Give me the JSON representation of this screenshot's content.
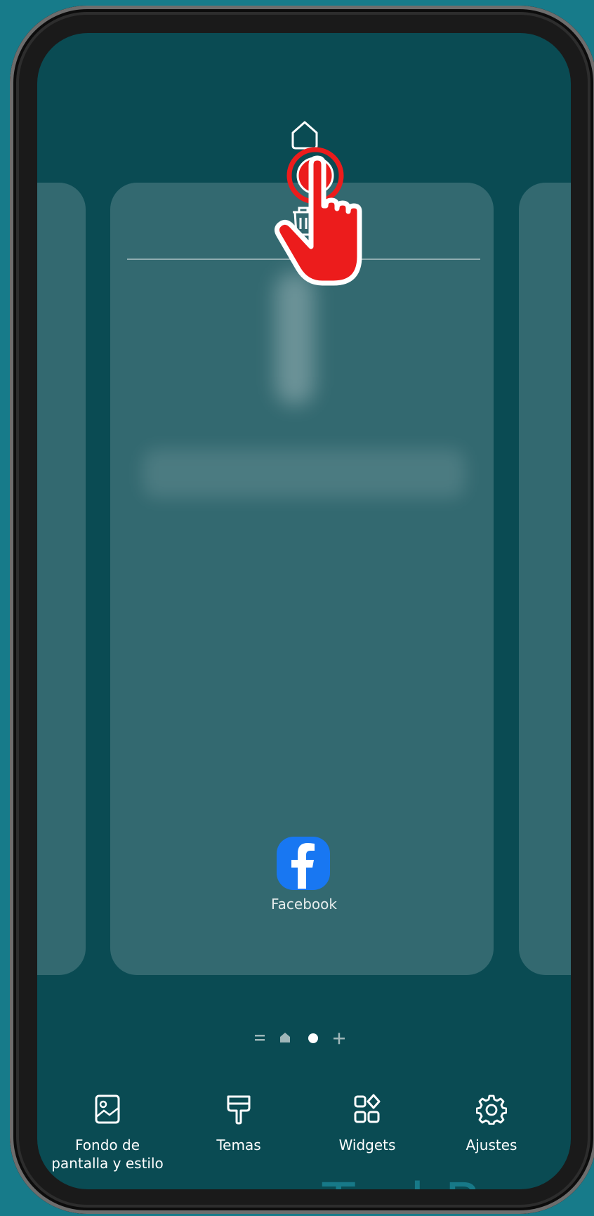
{
  "home_screen": {
    "app": {
      "label": "Facebook",
      "icon": "facebook-icon"
    },
    "page_indicator": [
      "list-icon",
      "home-page-icon",
      "current-page-dot",
      "add-page-icon"
    ]
  },
  "bottom_bar": {
    "wallpaper_label_line1": "Fondo de",
    "wallpaper_label_line2": "pantalla y estilo",
    "themes_label": "Temas",
    "widgets_label": "Widgets",
    "settings_label": "Ajustes"
  },
  "watermark": "TechBone",
  "colors": {
    "background": "#177b8a",
    "screen": "#0a4b53",
    "tap_indicator": "#ec1c1c",
    "facebook_blue": "#1877f2"
  }
}
